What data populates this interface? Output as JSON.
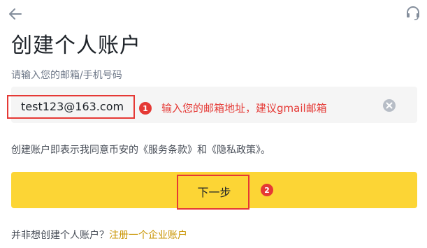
{
  "header": {
    "title": "创建个人账户",
    "back_icon": "arrow-left-icon",
    "support_icon": "headset-icon"
  },
  "form": {
    "label": "请输入您的邮箱/手机号码",
    "email_value": "test123@163.com",
    "clear_icon": "close-circle-icon"
  },
  "annotations": {
    "badge_1": "1",
    "note_1": "输入您的邮箱地址，建议gmail邮箱",
    "badge_2": "2",
    "color": "#e53935"
  },
  "terms": "创建账户即表示我同意币安的《服务条款》和《隐私政策》。",
  "next_button": {
    "label": "下一步",
    "color": "#fcd535"
  },
  "footer": {
    "question": "并非想创建个人账户？",
    "link": "注册一个企业账户",
    "link_color": "#c99400"
  }
}
